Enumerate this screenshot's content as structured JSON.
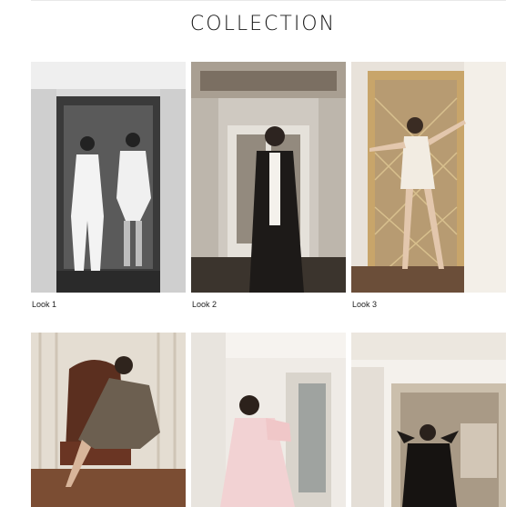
{
  "page": {
    "title": "COLLECTION"
  },
  "looks": [
    {
      "caption": "Look 1",
      "scene": "black-and-white elevator doorway, two women in white suits"
    },
    {
      "caption": "Look 2",
      "scene": "elevator hall, woman in black leather coat"
    },
    {
      "caption": "Look 3",
      "scene": "gold lattice door, woman in white mini dress"
    },
    {
      "caption": "",
      "scene": "leather armchair, woman in tweed dress"
    },
    {
      "caption": "",
      "scene": "curtained window, woman in pink gown"
    },
    {
      "caption": "",
      "scene": "white paneled doorway, woman in black dress"
    }
  ],
  "colors": {
    "title": "#151515",
    "caption": "#222222"
  }
}
